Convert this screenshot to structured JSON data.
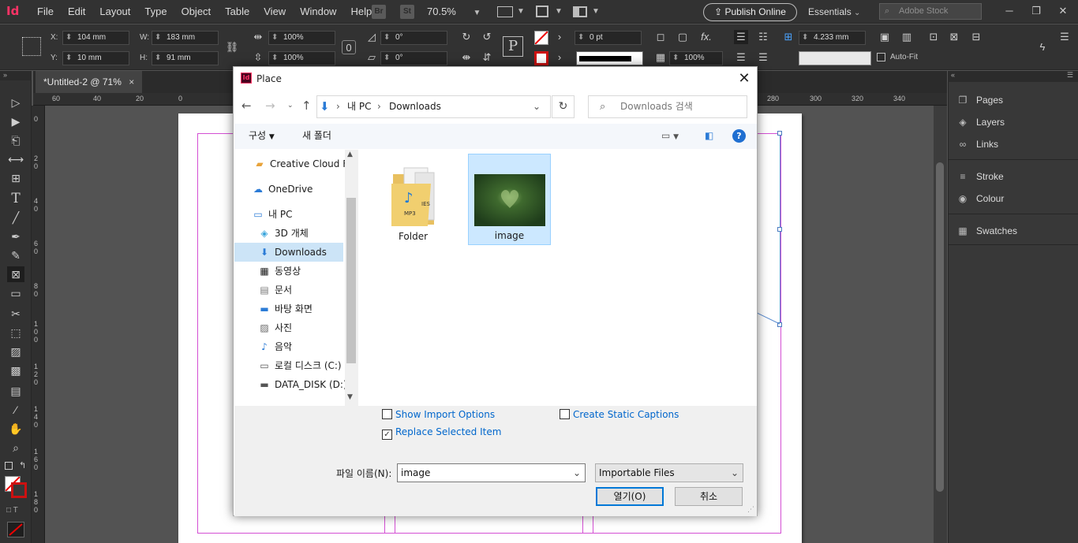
{
  "app": {
    "logo": "Id",
    "menu": [
      "File",
      "Edit",
      "Layout",
      "Type",
      "Object",
      "Table",
      "View",
      "Window",
      "Help"
    ],
    "bridge_label": "Br",
    "stock_label": "St",
    "zoom": "70.5%",
    "publish_online": "Publish Online",
    "workspace": "Essentials",
    "search_placeholder": "Adobe Stock"
  },
  "control_panel": {
    "x_label": "X:",
    "x_value": "104 mm",
    "y_label": "Y:",
    "y_value": "10 mm",
    "w_label": "W:",
    "w_value": "183 mm",
    "h_label": "H:",
    "h_value": "91 mm",
    "scale_x": "100%",
    "scale_y": "100%",
    "rotate": "0°",
    "shear": "0°",
    "stroke_weight": "0 pt",
    "opacity": "100%",
    "spacing": "4.233 mm",
    "auto_fit": "Auto-Fit"
  },
  "document": {
    "tab_title": "*Untitled-2 @ 71%",
    "hruler_ticks": [
      "60",
      "40",
      "20",
      "0",
      "280",
      "300",
      "320",
      "340"
    ],
    "vruler_ticks": [
      "0",
      "2 0",
      "4 0",
      "6 0",
      "8 0",
      "1 0 0",
      "1 2 0",
      "1 4 0",
      "1 6 0",
      "1 8 0"
    ]
  },
  "panels": {
    "items": [
      "Pages",
      "Layers",
      "Links",
      "Stroke",
      "Colour",
      "Swatches"
    ]
  },
  "dialog": {
    "title": "Place",
    "address": {
      "root": "내 PC",
      "current": "Downloads"
    },
    "search_placeholder": "Downloads 검색",
    "organize": "구성",
    "new_folder": "새 폴더",
    "nav": [
      {
        "label": "Creative Cloud Fil",
        "icon": "cc"
      },
      {
        "label": "OneDrive",
        "icon": "cloud"
      },
      {
        "label": "내 PC",
        "icon": "pc"
      },
      {
        "label": "3D 개체",
        "icon": "cube"
      },
      {
        "label": "Downloads",
        "icon": "download"
      },
      {
        "label": "동영상",
        "icon": "film"
      },
      {
        "label": "문서",
        "icon": "doc"
      },
      {
        "label": "바탕 화면",
        "icon": "desktop"
      },
      {
        "label": "사진",
        "icon": "picture"
      },
      {
        "label": "음악",
        "icon": "music"
      },
      {
        "label": "로컬 디스크 (C:)",
        "icon": "disk"
      },
      {
        "label": "DATA_DISK (D:)",
        "icon": "disk"
      }
    ],
    "files": [
      {
        "name": "Folder",
        "type": "folder"
      },
      {
        "name": "image",
        "type": "image",
        "selected": true
      }
    ],
    "show_import_options": "Show Import Options",
    "create_static_captions": "Create Static Captions",
    "replace_selected_item": "Replace Selected Item",
    "filename_label": "파일 이름(N):",
    "filename_value": "image",
    "filetype": "Importable Files",
    "open_button": "열기(O)",
    "cancel_button": "취소",
    "mp3_label": "MP3",
    "files_label": "IES"
  }
}
